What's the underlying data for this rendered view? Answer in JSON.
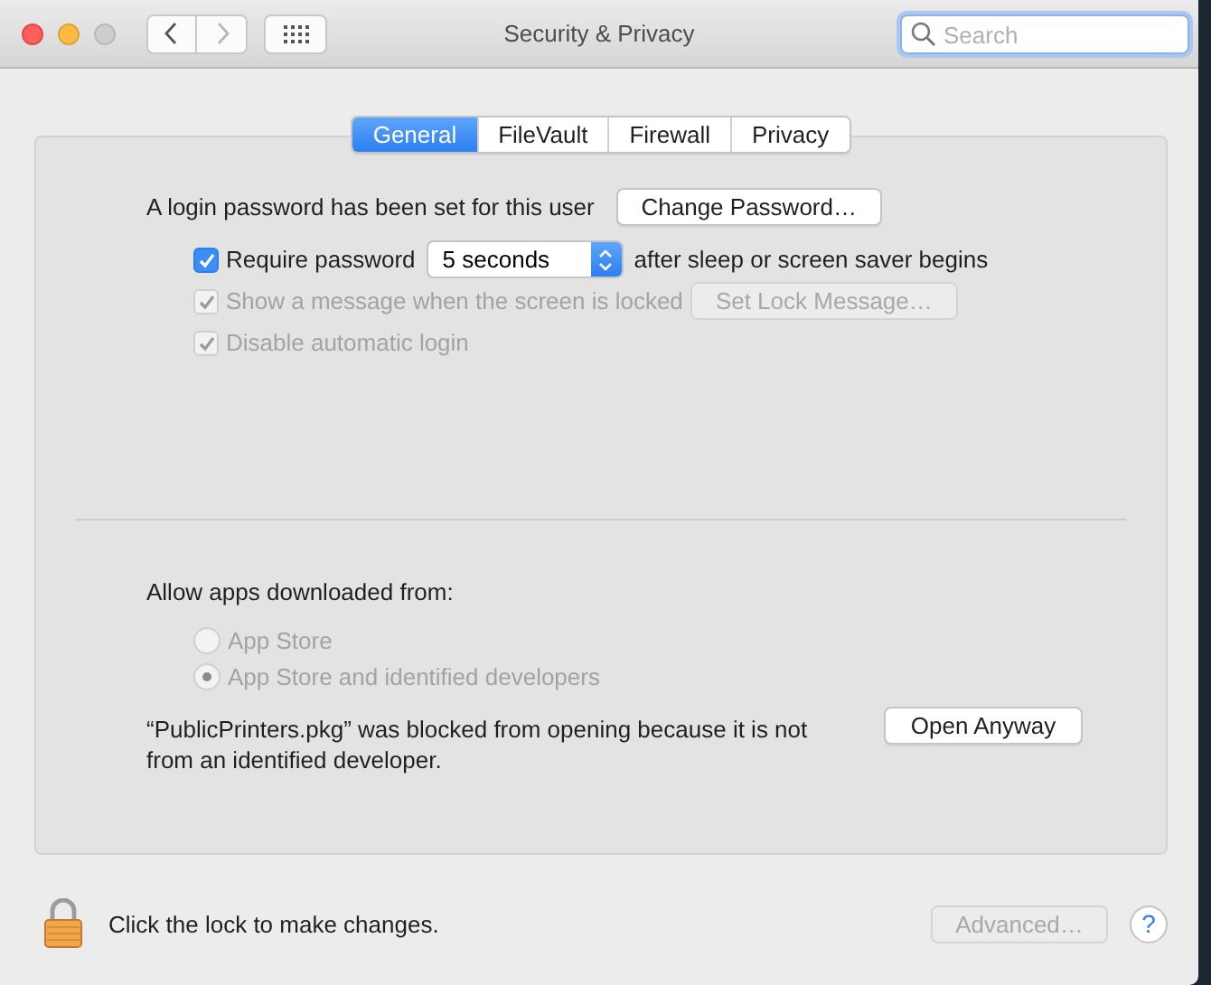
{
  "window": {
    "title": "Security & Privacy"
  },
  "toolbar": {
    "search": {
      "placeholder": "Search"
    }
  },
  "tabs": [
    {
      "label": "General",
      "selected": true
    },
    {
      "label": "FileVault",
      "selected": false
    },
    {
      "label": "Firewall",
      "selected": false
    },
    {
      "label": "Privacy",
      "selected": false
    }
  ],
  "password": {
    "status_text": "A login password has been set for this user",
    "change_button": "Change Password…"
  },
  "options": [
    {
      "kind": "popup",
      "label": "Require password",
      "checked": true,
      "disabled": false,
      "popup_value": "5 seconds",
      "suffix": "after sleep or screen saver begins"
    },
    {
      "kind": "button",
      "label": "Show a message when the screen is locked",
      "checked": true,
      "disabled": true,
      "button": "Set Lock Message…"
    },
    {
      "kind": "plain",
      "label": "Disable automatic login",
      "checked": true,
      "disabled": true
    }
  ],
  "gatekeeper": {
    "heading": "Allow apps downloaded from:",
    "choices": [
      {
        "label": "App Store",
        "selected": false,
        "disabled": true
      },
      {
        "label": "App Store and identified developers",
        "selected": true,
        "disabled": true
      }
    ],
    "blocked_message": "“PublicPrinters.pkg” was blocked from opening because it is not from an identified developer.",
    "open_button": "Open Anyway"
  },
  "footer": {
    "lock_text": "Click the lock to make changes.",
    "locked": true,
    "advanced_button": "Advanced…",
    "advanced_disabled": true,
    "help_button": "?"
  }
}
